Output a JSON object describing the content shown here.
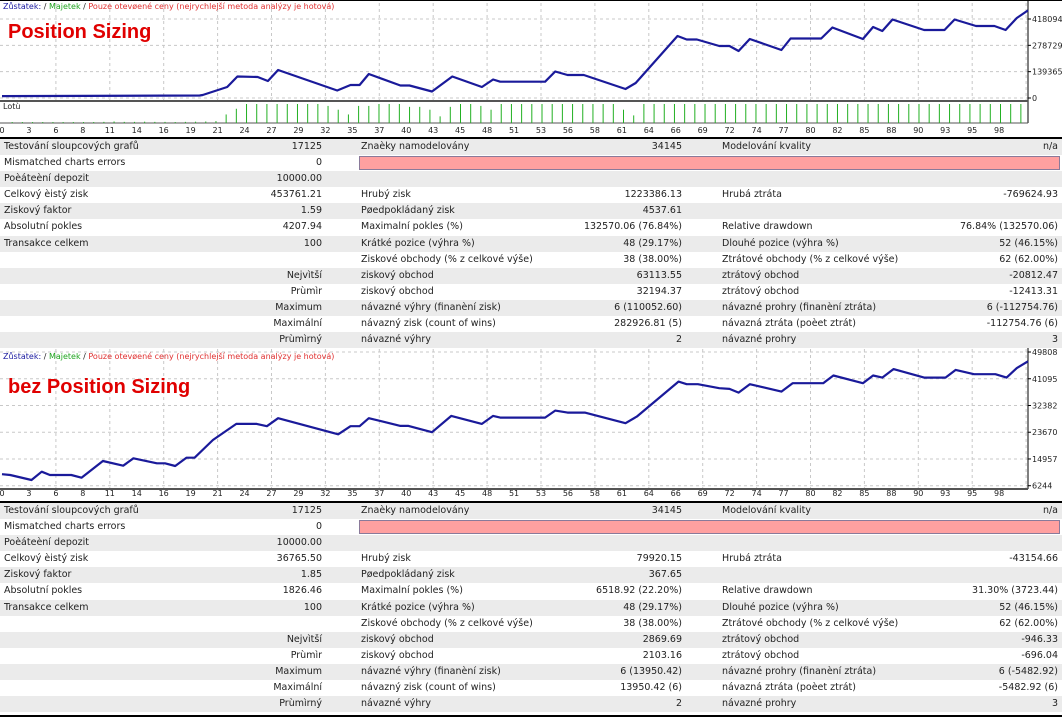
{
  "legend": {
    "balance": "Zůstatek:",
    "separator": "/",
    "equity": "Majetek",
    "mode": "Pouze otevøené ceny (nejrychlejší metoda analýzy je hotová)"
  },
  "colors": {
    "balance_line": "#1a1a9a",
    "equity_line": "#2aa84a",
    "lots_bars": "#22b022",
    "title": "#e00000",
    "error_bar": "#ffa0a0",
    "grid": "#c8c8c8"
  },
  "reports": [
    {
      "title": "Position Sizing",
      "lots_label": "Lotù",
      "rows": [
        {
          "c1l": "Testování sloupcových grafů",
          "c1v": "17125",
          "c2l": "Znaèky namodelovány",
          "c2v": "34145",
          "c3l": "Modelování kvality",
          "c3v": "n/a"
        },
        {
          "c1l": "Mismatched charts errors",
          "c1v": "0",
          "c2l": "",
          "c2v": "",
          "c3l": "",
          "c3v": "",
          "error_bar": true
        },
        {
          "c1l": "Poèáteèní depozit",
          "c1v": "10000.00",
          "c2l": "",
          "c2v": "",
          "c3l": "",
          "c3v": ""
        },
        {
          "c1l": "Celkový èistý zisk",
          "c1v": "453761.21",
          "c2l": "Hrubý zisk",
          "c2v": "1223386.13",
          "c3l": "Hrubá ztráta",
          "c3v": "-769624.93"
        },
        {
          "c1l": "Ziskový faktor",
          "c1v": "1.59",
          "c2l": "Pøedpokládaný zisk",
          "c2v": "4537.61",
          "c3l": "",
          "c3v": ""
        },
        {
          "c1l": "Absolutní pokles",
          "c1v": "4207.94",
          "c2l": "Maximalní pokles (%)",
          "c2v": "132570.06 (76.84%)",
          "c3l": "Relative drawdown",
          "c3v": "76.84% (132570.06)"
        },
        {
          "c1l": "Transakce celkem",
          "c1v": "100",
          "c2l": "Krátké pozice (výhra %)",
          "c2v": "48 (29.17%)",
          "c3l": "Dlouhé pozice (výhra %)",
          "c3v": "52 (46.15%)"
        },
        {
          "c1l": "",
          "c1v": "",
          "c2l": "Ziskové obchody (% z celkové výše)",
          "c2v": "38 (38.00%)",
          "c3l": "Ztrátové obchody (% z celkové výše)",
          "c3v": "62 (62.00%)"
        },
        {
          "c1l": "",
          "c1v": "Nejvìtší",
          "c2l": "ziskový obchod",
          "c2v": "63113.55",
          "c3l": "ztrátový obchod",
          "c3v": "-20812.47"
        },
        {
          "c1l": "",
          "c1v": "Prùmìr",
          "c2l": "ziskový obchod",
          "c2v": "32194.37",
          "c3l": "ztrátový obchod",
          "c3v": "-12413.31"
        },
        {
          "c1l": "",
          "c1v": "Maximum",
          "c2l": "návazné výhry (finanèní zisk)",
          "c2v": "6 (110052.60)",
          "c3l": "návazné prohry (finanèní ztráta)",
          "c3v": "6 (-112754.76)"
        },
        {
          "c1l": "",
          "c1v": "Maximální",
          "c2l": "návazný zisk (count of wins)",
          "c2v": "282926.81 (5)",
          "c3l": "návazná ztráta (poèet ztrát)",
          "c3v": "-112754.76 (6)"
        },
        {
          "c1l": "",
          "c1v": "Prùmìrný",
          "c2l": "návazné výhry",
          "c2v": "2",
          "c3l": "návazné prohry",
          "c3v": "3"
        }
      ]
    },
    {
      "title": "bez Position Sizing",
      "rows": [
        {
          "c1l": "Testování sloupcových grafů",
          "c1v": "17125",
          "c2l": "Znaèky namodelovány",
          "c2v": "34145",
          "c3l": "Modelování kvality",
          "c3v": "n/a"
        },
        {
          "c1l": "Mismatched charts errors",
          "c1v": "0",
          "c2l": "",
          "c2v": "",
          "c3l": "",
          "c3v": "",
          "error_bar": true
        },
        {
          "c1l": "Poèáteèní depozit",
          "c1v": "10000.00",
          "c2l": "",
          "c2v": "",
          "c3l": "",
          "c3v": ""
        },
        {
          "c1l": "Celkový èistý zisk",
          "c1v": "36765.50",
          "c2l": "Hrubý zisk",
          "c2v": "79920.15",
          "c3l": "Hrubá ztráta",
          "c3v": "-43154.66"
        },
        {
          "c1l": "Ziskový faktor",
          "c1v": "1.85",
          "c2l": "Pøedpokládaný zisk",
          "c2v": "367.65",
          "c3l": "",
          "c3v": ""
        },
        {
          "c1l": "Absolutní pokles",
          "c1v": "1826.46",
          "c2l": "Maximalní pokles (%)",
          "c2v": "6518.92 (22.20%)",
          "c3l": "Relative drawdown",
          "c3v": "31.30% (3723.44)"
        },
        {
          "c1l": "Transakce celkem",
          "c1v": "100",
          "c2l": "Krátké pozice (výhra %)",
          "c2v": "48 (29.17%)",
          "c3l": "Dlouhé pozice (výhra %)",
          "c3v": "52 (46.15%)"
        },
        {
          "c1l": "",
          "c1v": "",
          "c2l": "Ziskové obchody (% z celkové výše)",
          "c2v": "38 (38.00%)",
          "c3l": "Ztrátové obchody (% z celkové výše)",
          "c3v": "62 (62.00%)"
        },
        {
          "c1l": "",
          "c1v": "Nejvìtší",
          "c2l": "ziskový obchod",
          "c2v": "2869.69",
          "c3l": "ztrátový obchod",
          "c3v": "-946.33"
        },
        {
          "c1l": "",
          "c1v": "Prùmìr",
          "c2l": "ziskový obchod",
          "c2v": "2103.16",
          "c3l": "ztrátový obchod",
          "c3v": "-696.04"
        },
        {
          "c1l": "",
          "c1v": "Maximum",
          "c2l": "návazné výhry (finanèní zisk)",
          "c2v": "6 (13950.42)",
          "c3l": "návazné prohry (finanèní ztráta)",
          "c3v": "6 (-5482.92)"
        },
        {
          "c1l": "",
          "c1v": "Maximální",
          "c2l": "návazný zisk (count of wins)",
          "c2v": "13950.42 (6)",
          "c3l": "návazná ztráta (poèet ztrát)",
          "c3v": "-5482.92 (6)"
        },
        {
          "c1l": "",
          "c1v": "Prùmìrný",
          "c2l": "návazné výhry",
          "c2v": "2",
          "c3l": "návazné prohry",
          "c3v": "3"
        }
      ]
    }
  ],
  "chart_data": [
    {
      "type": "line",
      "title": "Position Sizing",
      "xtick_labels": [
        "0",
        "3",
        "6",
        "8",
        "11",
        "14",
        "16",
        "19",
        "21",
        "24",
        "27",
        "29",
        "32",
        "35",
        "37",
        "40",
        "43",
        "45",
        "48",
        "51",
        "53",
        "56",
        "58",
        "61",
        "64",
        "66",
        "69",
        "72",
        "74",
        "77",
        "80",
        "82",
        "85",
        "88",
        "90",
        "93",
        "95",
        "98"
      ],
      "ytick_labels": [
        "418094",
        "278729",
        "139365",
        "0"
      ],
      "ytick_values": [
        418094,
        278729,
        139365,
        0
      ],
      "xlim": [
        0,
        100.7
      ],
      "ylim": [
        0,
        502770
      ],
      "grid": true,
      "series": [
        {
          "name": "Zůstatek",
          "points": [
            [
              0,
              10000
            ],
            [
              19.4,
              13000
            ],
            [
              19.7,
              15900
            ],
            [
              22.1,
              58200
            ],
            [
              23.1,
              113800
            ],
            [
              25.1,
              111100
            ],
            [
              26.1,
              90000
            ],
            [
              27.1,
              148200
            ],
            [
              32.9,
              39700
            ],
            [
              34.2,
              68800
            ],
            [
              35.1,
              68800
            ],
            [
              36.0,
              127000
            ],
            [
              39.1,
              66200
            ],
            [
              40.0,
              66200
            ],
            [
              42.2,
              34400
            ],
            [
              44.2,
              113800
            ],
            [
              47.1,
              58200
            ],
            [
              48.2,
              97900
            ],
            [
              48.9,
              86300
            ],
            [
              53.3,
              86300
            ],
            [
              54.3,
              140200
            ],
            [
              55.5,
              121700
            ],
            [
              57.1,
              121700
            ],
            [
              61.2,
              47600
            ],
            [
              62.2,
              79400
            ],
            [
              66.3,
              328100
            ],
            [
              67.2,
              309600
            ],
            [
              68.2,
              309600
            ],
            [
              70.4,
              275200
            ],
            [
              71.4,
              275200
            ],
            [
              72.3,
              248700
            ],
            [
              73.4,
              312200
            ],
            [
              76.5,
              254000
            ],
            [
              77.4,
              314900
            ],
            [
              80.4,
              314900
            ],
            [
              81.5,
              373100
            ],
            [
              84.5,
              312200
            ],
            [
              85.5,
              375700
            ],
            [
              86.4,
              354600
            ],
            [
              87.4,
              415400
            ],
            [
              90.5,
              359900
            ],
            [
              92.5,
              359900
            ],
            [
              93.5,
              415400
            ],
            [
              95.6,
              381000
            ],
            [
              97.4,
              381000
            ],
            [
              98.5,
              359900
            ],
            [
              99.6,
              423400
            ],
            [
              100.7,
              463761
            ]
          ]
        }
      ],
      "lots": [
        0.05,
        0.05,
        0.05,
        0.05,
        0.05,
        0.05,
        0.05,
        0.05,
        0.05,
        0.06,
        0.08,
        0.06,
        0.06,
        0.07,
        0.06,
        0.06,
        0.05,
        0.06,
        0.07,
        0.08,
        0.1,
        0.45,
        0.75,
        1,
        1,
        1,
        1,
        1,
        1,
        1,
        1,
        0.9,
        0.7,
        0.45,
        0.9,
        0.9,
        1,
        1,
        1,
        0.85,
        0.85,
        0.7,
        0.35,
        0.85,
        1,
        1,
        0.9,
        0.7,
        1,
        1,
        1,
        1,
        1,
        1,
        1,
        1,
        1,
        1,
        1,
        1,
        0.7,
        0.4,
        1,
        1,
        1,
        1,
        1,
        1,
        1,
        1,
        1,
        1,
        1,
        1,
        1,
        1,
        1,
        1,
        1,
        1,
        1,
        1,
        1,
        1,
        1,
        1,
        1,
        1,
        1,
        1,
        1,
        1,
        1,
        1,
        1,
        1,
        1,
        1,
        1,
        1
      ]
    },
    {
      "type": "line",
      "title": "bez Position Sizing",
      "xtick_labels": [
        "0",
        "3",
        "6",
        "8",
        "11",
        "14",
        "16",
        "19",
        "21",
        "24",
        "27",
        "29",
        "32",
        "35",
        "37",
        "40",
        "43",
        "45",
        "48",
        "51",
        "53",
        "56",
        "58",
        "61",
        "64",
        "66",
        "69",
        "72",
        "74",
        "77",
        "80",
        "82",
        "85",
        "88",
        "90",
        "93",
        "95",
        "98"
      ],
      "ytick_labels": [
        "49808",
        "41095",
        "32382",
        "23670",
        "14957",
        "6244"
      ],
      "ytick_values": [
        49808,
        41095,
        32382,
        23670,
        14957,
        6244
      ],
      "xlim": [
        0,
        100.7
      ],
      "ylim": [
        5170,
        50790
      ],
      "grid": true,
      "series": [
        {
          "name": "Zůstatek",
          "points": [
            [
              0,
              10000
            ],
            [
              0.8,
              9740
            ],
            [
              2.9,
              8100
            ],
            [
              3.9,
              10800
            ],
            [
              4.7,
              9740
            ],
            [
              6.8,
              9740
            ],
            [
              7.8,
              8850
            ],
            [
              9.9,
              14300
            ],
            [
              11.9,
              12770
            ],
            [
              12.9,
              15180
            ],
            [
              15.2,
              13550
            ],
            [
              16.0,
              13550
            ],
            [
              17.0,
              12670
            ],
            [
              18.1,
              15380
            ],
            [
              18.9,
              15380
            ],
            [
              20.7,
              21150
            ],
            [
              23.0,
              26370
            ],
            [
              25.0,
              26370
            ],
            [
              26.0,
              25630
            ],
            [
              27.1,
              28230
            ],
            [
              33.0,
              23010
            ],
            [
              34.2,
              25630
            ],
            [
              35.1,
              25630
            ],
            [
              36.0,
              28230
            ],
            [
              39.1,
              25720
            ],
            [
              39.9,
              25720
            ],
            [
              42.2,
              23670
            ],
            [
              44.1,
              28990
            ],
            [
              47.1,
              26370
            ],
            [
              48.2,
              28990
            ],
            [
              48.9,
              28430
            ],
            [
              53.3,
              28430
            ],
            [
              54.3,
              30720
            ],
            [
              55.5,
              30060
            ],
            [
              57.2,
              30060
            ],
            [
              61.2,
              26600
            ],
            [
              62.3,
              28760
            ],
            [
              66.4,
              40180
            ],
            [
              67.2,
              39330
            ],
            [
              68.3,
              39330
            ],
            [
              70.4,
              38020
            ],
            [
              71.4,
              37800
            ],
            [
              72.3,
              36590
            ],
            [
              73.4,
              39330
            ],
            [
              76.5,
              36910
            ],
            [
              77.6,
              39660
            ],
            [
              80.6,
              39660
            ],
            [
              81.6,
              42140
            ],
            [
              84.5,
              39660
            ],
            [
              85.5,
              42140
            ],
            [
              86.4,
              41480
            ],
            [
              87.5,
              44230
            ],
            [
              90.5,
              41480
            ],
            [
              92.6,
              41480
            ],
            [
              93.6,
              43990
            ],
            [
              95.4,
              42590
            ],
            [
              97.5,
              42590
            ],
            [
              98.6,
              41480
            ],
            [
              99.6,
              44550
            ],
            [
              100.7,
              46766
            ]
          ]
        }
      ]
    }
  ]
}
